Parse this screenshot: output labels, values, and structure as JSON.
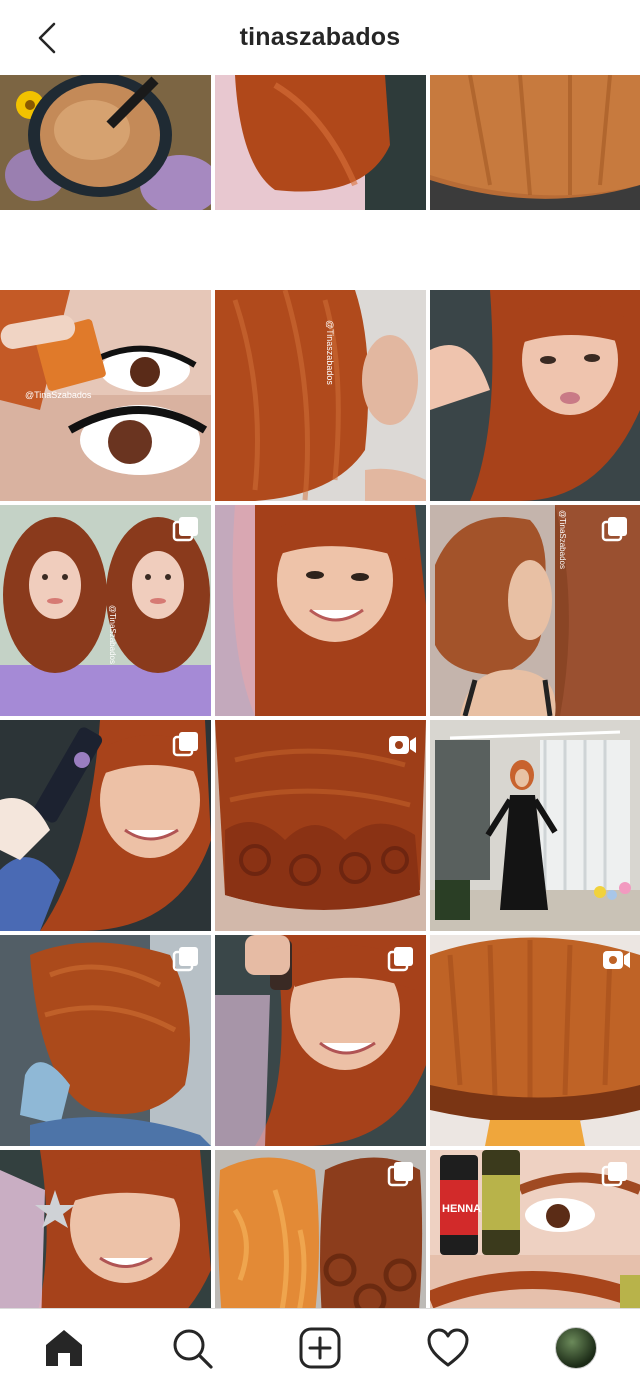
{
  "header": {
    "title": "tinaszabados",
    "back_icon": "chevron-left-icon"
  },
  "colors": {
    "text": "#262626",
    "divider": "#dbdbdb",
    "hair_copper": "#b5521f"
  },
  "grid": {
    "tiles": [
      {
        "name": "post-henna-bowl",
        "badge": "none",
        "watermark": ""
      },
      {
        "name": "post-copper-bob-side",
        "badge": "none",
        "watermark": ""
      },
      {
        "name": "post-copper-bob-back",
        "badge": "none",
        "watermark": ""
      },
      {
        "name": "post-eyelash-closeup",
        "badge": "none",
        "watermark": "@TinaSzabados"
      },
      {
        "name": "post-long-copper-hair-profile",
        "badge": "none",
        "watermark": "@Tinaszabados"
      },
      {
        "name": "post-bangs-selfie-lips",
        "badge": "none",
        "watermark": ""
      },
      {
        "name": "post-curly-redhead-duo",
        "badge": "carousel",
        "watermark": "@TinaSzabados"
      },
      {
        "name": "post-bangs-selfie-smile",
        "badge": "none",
        "watermark": ""
      },
      {
        "name": "post-voluminous-blowout",
        "badge": "carousel",
        "watermark": "@TinaSzabados"
      },
      {
        "name": "post-product-bottle-selfie",
        "badge": "carousel",
        "watermark": ""
      },
      {
        "name": "post-wavy-copper-back",
        "badge": "video",
        "watermark": ""
      },
      {
        "name": "post-black-dress-room",
        "badge": "none",
        "watermark": ""
      },
      {
        "name": "post-angled-bob",
        "badge": "carousel",
        "watermark": ""
      },
      {
        "name": "post-bottle-selfie-laugh",
        "badge": "carousel",
        "watermark": ""
      },
      {
        "name": "post-stacked-bob-back",
        "badge": "video",
        "watermark": ""
      },
      {
        "name": "post-sparkle-bangs-selfie",
        "badge": "none",
        "watermark": ""
      },
      {
        "name": "post-ginger-curls-compare",
        "badge": "carousel",
        "watermark": ""
      },
      {
        "name": "post-henna-brows-products",
        "badge": "carousel",
        "watermark": "",
        "label1": "HENNA"
      },
      {
        "name": "post-partial-1",
        "badge": "none",
        "watermark": ""
      },
      {
        "name": "post-partial-2",
        "badge": "none",
        "watermark": ""
      },
      {
        "name": "post-partial-3",
        "badge": "none",
        "watermark": ""
      }
    ]
  },
  "tabbar": {
    "items": [
      {
        "name": "tab-home",
        "icon": "home-icon"
      },
      {
        "name": "tab-search",
        "icon": "search-icon"
      },
      {
        "name": "tab-new-post",
        "icon": "plus-square-icon"
      },
      {
        "name": "tab-activity",
        "icon": "heart-icon"
      },
      {
        "name": "tab-profile",
        "icon": "avatar"
      }
    ]
  }
}
